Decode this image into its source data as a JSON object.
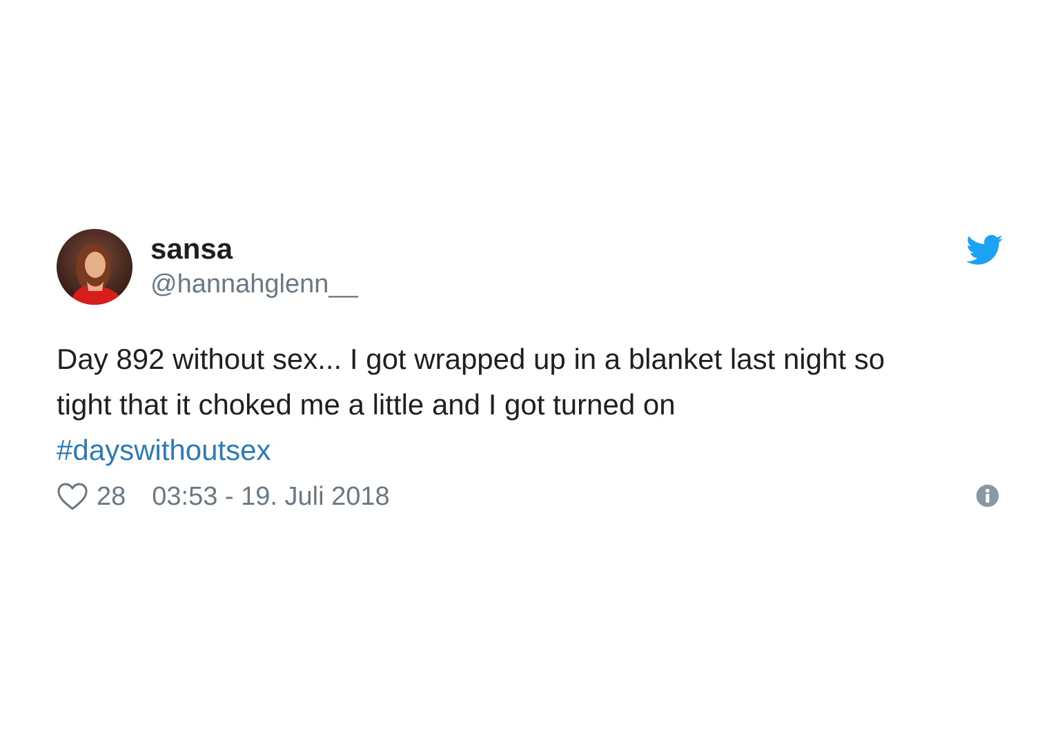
{
  "tweet": {
    "display_name": "sansa",
    "handle": "@hannahglenn__",
    "text_lines": [
      "Day 892 without sex... I got wrapped up in a blanket last night so",
      "tight that it choked me a little and I got turned on"
    ],
    "hashtag": "#dayswithoutsex",
    "like_count": "28",
    "timestamp": "03:53 - 19. Juli 2018",
    "icons": {
      "brand": "twitter-bird-icon",
      "like": "heart-icon",
      "info": "info-icon"
    },
    "colors": {
      "text": "#1c2022",
      "secondary": "#697882",
      "link": "#2b7bb9",
      "twitter_blue": "#1da1f2",
      "info_icon": "#8899a6"
    }
  }
}
